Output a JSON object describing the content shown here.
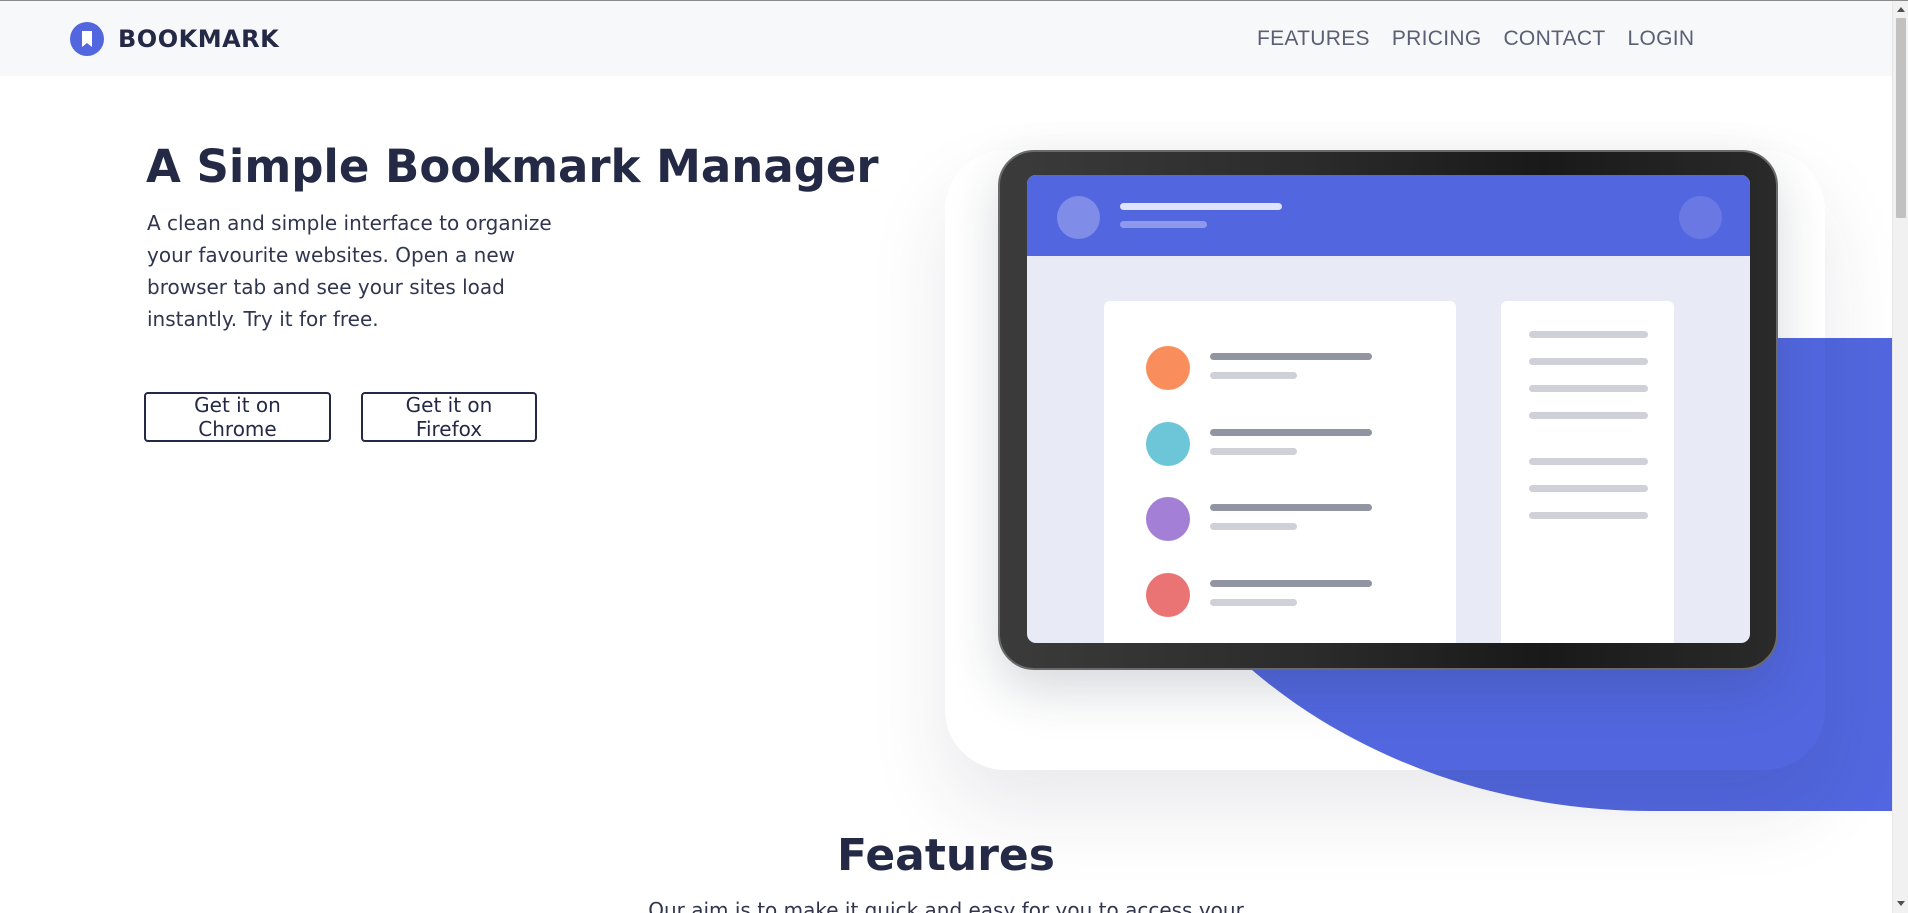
{
  "header": {
    "brand": "BOOKMARK",
    "nav": [
      {
        "label": "FEATURES"
      },
      {
        "label": "PRICING"
      },
      {
        "label": "CONTACT"
      },
      {
        "label": "LOGIN"
      }
    ]
  },
  "hero": {
    "title": "A Simple Bookmark Manager",
    "description": "A clean and simple interface to organize your favourite websites. Open a new browser tab and see your sites load instantly. Try it for free.",
    "chrome_button": "Get it on Chrome",
    "firefox_button": "Get it on Firefox"
  },
  "illustration": {
    "item_colors": [
      "#f98e5c",
      "#6cc6d8",
      "#a47fd6",
      "#ea7474"
    ]
  },
  "features": {
    "title": "Features",
    "intro": "Our aim is to make it quick and easy for you to access your"
  },
  "colors": {
    "accent": "#5267df",
    "dark": "#242a45"
  }
}
